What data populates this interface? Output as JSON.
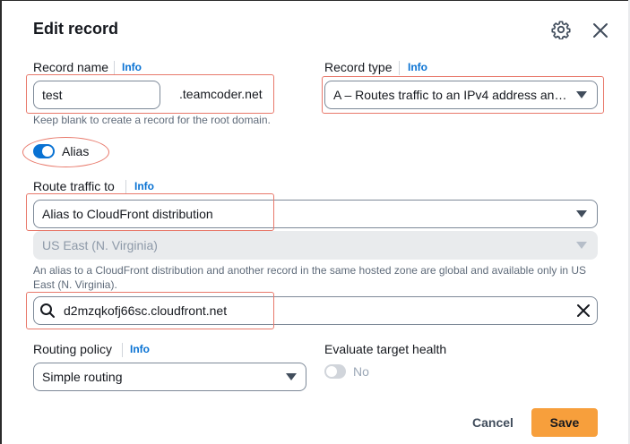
{
  "dialog": {
    "title": "Edit record",
    "settings_icon": "gear-icon",
    "close_icon": "close-icon"
  },
  "record_name": {
    "label": "Record name",
    "info": "Info",
    "value": "test",
    "domain_suffix": ".teamcoder.net",
    "help": "Keep blank to create a record for the root domain."
  },
  "record_type": {
    "label": "Record type",
    "info": "Info",
    "value": "A – Routes traffic to an IPv4 address an…"
  },
  "alias": {
    "label": "Alias",
    "enabled": true
  },
  "route_traffic": {
    "label": "Route traffic to",
    "info": "Info",
    "endpoint_value": "Alias to CloudFront distribution",
    "region_value": "US East (N. Virginia)",
    "help": "An alias to a CloudFront distribution and another record in the same hosted zone are global and available only in US East (N. Virginia).",
    "search_value": "d2mzqkofj66sc.cloudfront.net"
  },
  "routing_policy": {
    "label": "Routing policy",
    "info": "Info",
    "value": "Simple routing"
  },
  "evaluate_health": {
    "label": "Evaluate target health",
    "toggle_label": "No",
    "enabled": false
  },
  "footer": {
    "cancel_label": "Cancel",
    "save_label": "Save"
  },
  "colors": {
    "primary_button": "#f79f3c",
    "link": "#0972d3",
    "toggle_on": "#0972d3",
    "annotation": "#e8796b"
  }
}
